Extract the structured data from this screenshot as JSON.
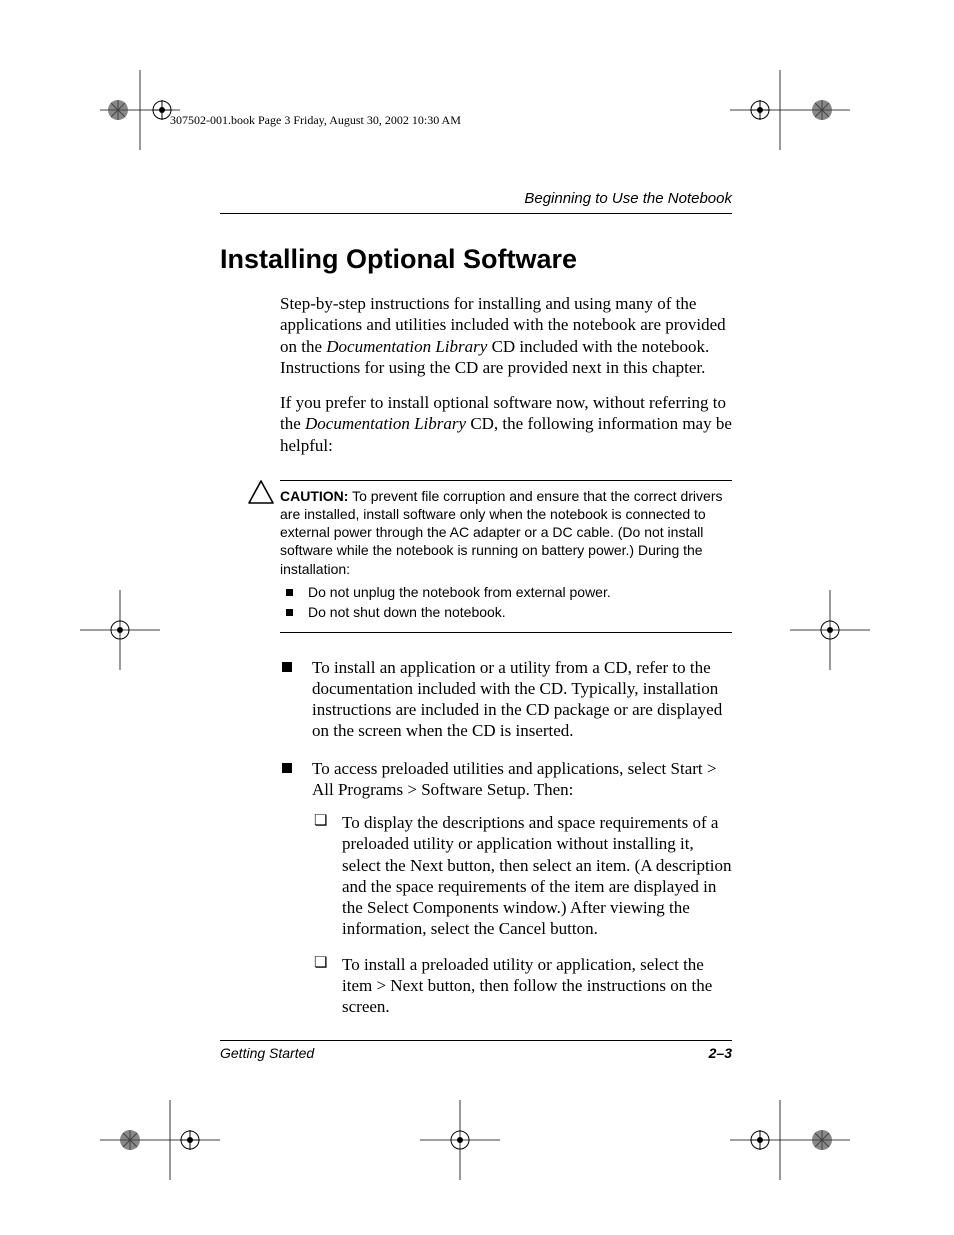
{
  "header_stamp": "307502-001.book  Page 3  Friday, August 30, 2002  10:30 AM",
  "chapter_title": "Beginning to Use the Notebook",
  "section_heading": "Installing Optional Software",
  "para1_a": "Step-by-step instructions for installing and using many of the applications and utilities included with the notebook are provided on the ",
  "para1_em": "Documentation Library",
  "para1_b": " CD included with the notebook. Instructions for using the CD are provided next in this chapter.",
  "para2_a": "If you prefer to install optional software now, without referring to the ",
  "para2_em": "Documentation Library",
  "para2_b": " CD, the following information may be helpful:",
  "caution_label": "CAUTION:",
  "caution_body": " To prevent file corruption and ensure that the correct drivers are installed, install software only when the notebook is connected to external power through the AC adapter or a DC cable. (Do not install software while the notebook is running on battery power.) During the installation:",
  "caution_items": [
    "Do not unplug the notebook from external power.",
    "Do not shut down the notebook."
  ],
  "bullets": {
    "b1": "To install an application or a utility from a CD, refer to the documentation included with the CD. Typically, installation instructions are included in the CD package or are displayed on the screen when the CD is inserted.",
    "b2": "To access preloaded utilities and applications, select Start > All Programs > Software Setup. Then:",
    "sub1": "To display the descriptions and space requirements of a preloaded utility or application without installing it, select the Next button, then select an item. (A description and the space requirements of the item are displayed in the Select Components window.) After viewing the information, select the Cancel button.",
    "sub2": "To install a preloaded utility or application, select the item > Next button, then follow the instructions on the screen."
  },
  "footer_left": "Getting Started",
  "footer_right": "2–3"
}
